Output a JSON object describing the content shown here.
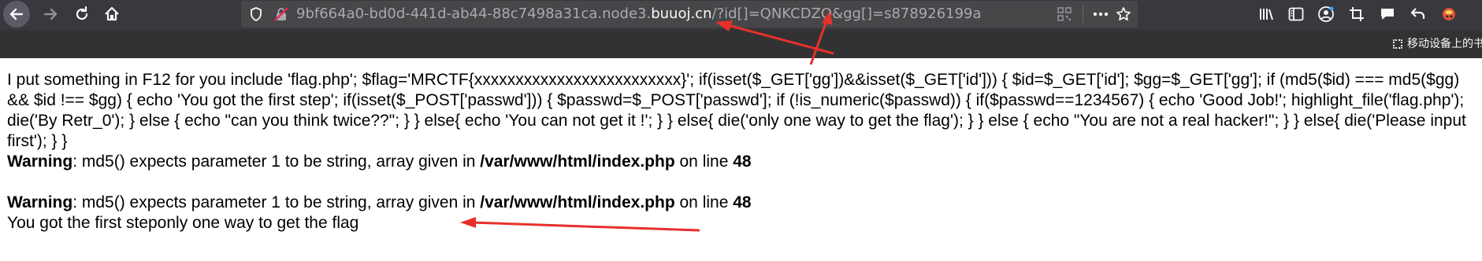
{
  "browser": {
    "url": {
      "prefix": "9bf664a0-bd0d-441d-ab44-88c7498a31ca.node3.",
      "domain": "buuoj.cn",
      "suffix": "/?id[]=QNKCDZO&gg[]=s878926199a"
    },
    "mobile_bookmarks_label": "移动设备上的书"
  },
  "page": {
    "source_lines": [
      "I put something in F12 for you include 'flag.php'; $flag='MRCTF{xxxxxxxxxxxxxxxxxxxxxxxxx}'; if(isset($_GET['gg'])&&isset($_GET['id'])) { $id=$_GET['id']; $gg=$_GET['gg']; if (md5($id) === md5($gg)",
      "&& $id !== $gg) { echo 'You got the first step'; if(isset($_POST['passwd'])) { $passwd=$_POST['passwd']; if (!is_numeric($passwd)) { if($passwd==1234567) { echo 'Good Job!'; highlight_file('flag.php');",
      "die('By Retr_0'); } else { echo \"can you think twice??\"; } } else{ echo 'You can not get it !'; } } else{ die('only one way to get the flag'); } } else { echo \"You are not a real hacker!\"; } } else{ die('Please input",
      "first'); } }"
    ],
    "warnings": [
      {
        "label": "Warning",
        "message": ": md5() expects parameter 1 to be string, array given in ",
        "file": "/var/www/html/index.php",
        "on_line_text": " on line ",
        "line_number": "48"
      },
      {
        "label": "Warning",
        "message": ": md5() expects parameter 1 to be string, array given in ",
        "file": "/var/www/html/index.php",
        "on_line_text": " on line ",
        "line_number": "48"
      }
    ],
    "output_text": "You got the first steponly one way to get the flag"
  },
  "colors": {
    "toolbar_bg": "#38383d",
    "urlbar_bg": "#474749",
    "annotation_arrow": "#e8302b"
  },
  "icons": [
    "back-arrow-icon",
    "forward-arrow-icon",
    "reload-icon",
    "home-icon",
    "shield-icon",
    "insecure-lock-icon",
    "qr-code-icon",
    "more-icon",
    "bookmark-star-icon",
    "library-icon",
    "sidebar-icon",
    "account-icon",
    "crop-icon",
    "chat-icon",
    "undo-icon",
    "extension-icon"
  ]
}
